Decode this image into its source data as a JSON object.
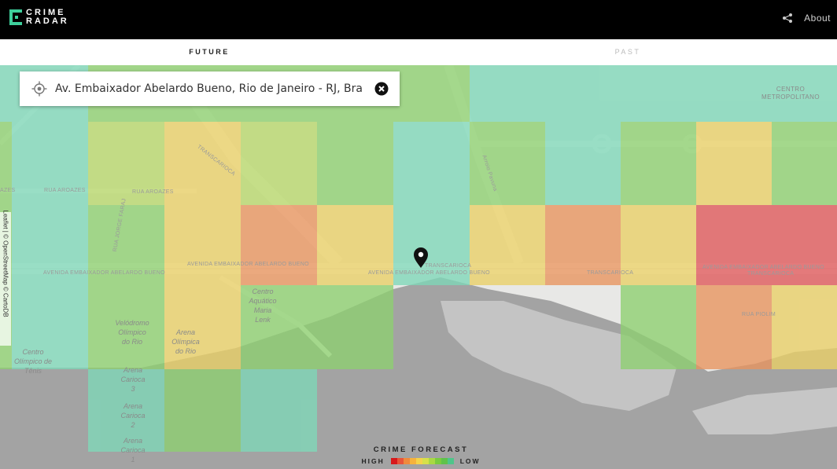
{
  "header": {
    "logo_line1": "CRIME",
    "logo_line2": "RADAR",
    "about": "About"
  },
  "tabs": [
    {
      "label": "FUTURE",
      "active": true
    },
    {
      "label": "PAST",
      "active": false
    }
  ],
  "search": {
    "value": "Av. Embaixador Abelardo Bueno, Rio de Janeiro - RJ, Bra"
  },
  "attribution": "Leaflet | © OpenStreetMap © CartoDB",
  "legend": {
    "title": "CRIME FORECAST",
    "high": "HIGH",
    "low": "LOW",
    "colors": [
      "#d7191c",
      "#e8543a",
      "#f08a3c",
      "#f6b23d",
      "#f4d34a",
      "#d7e04a",
      "#a9d843",
      "#7acb3f",
      "#5fc24a",
      "#4fc58a"
    ]
  },
  "map_labels": {
    "centro_metropolitano": "CENTRO\nMETROPOLITANO",
    "velodromo": "Velódromo\nOlímpico\ndo Rio",
    "arena_olimpica": "Arena\nOlímpica\ndo Rio",
    "centro_aquatico": "Centro\nAquático\nMaria\nLenk",
    "centro_tenis": "Centro\nOlímpico de\nTênis",
    "arena_carioca_3": "Arena\nCarioca\n3",
    "arena_carioca_2": "Arena\nCarioca\n2",
    "arena_carioca_1": "Arena\nCarioca\n1",
    "street_abelardo_1": "AVENIDA EMBAIXADOR ABELARDO BUENO",
    "street_abelardo_2": "AVENIDA EMBAIXADOR ABELARDO BUENO",
    "street_abelardo_3": "AVENIDA EMBAIXADOR ABELARDO BUENO",
    "street_abelardo_4": "AVENIDA EMBAIXADOR ABELARDO BUENO",
    "street_transcarioca_1": "TRANSCARIOCA",
    "street_transcarioca_2": "TRANSCARIOCA",
    "street_transcarioca_3": "TRANSCARIOCA",
    "street_transcarioca_4": "TRANSCARIOCA",
    "street_aroazes_1": "RUA AROAZES",
    "street_aroazes_2": "RUA AROAZES",
    "street_jorge_faraj": "RUA JORGE FARAJ",
    "street_arroio_pavuna": "Arroio Pavuna",
    "street_piolim": "RUA PIOLIM",
    "street_azes": "AZES"
  },
  "colors": {
    "red": "#e0585a",
    "orange": "#e9945e",
    "yellow": "#ead066",
    "light_green": "#b8d86a",
    "green": "#8ed070",
    "teal": "#7fd8b8",
    "water": "#a3a3a3",
    "land": "#e8e8e6"
  }
}
